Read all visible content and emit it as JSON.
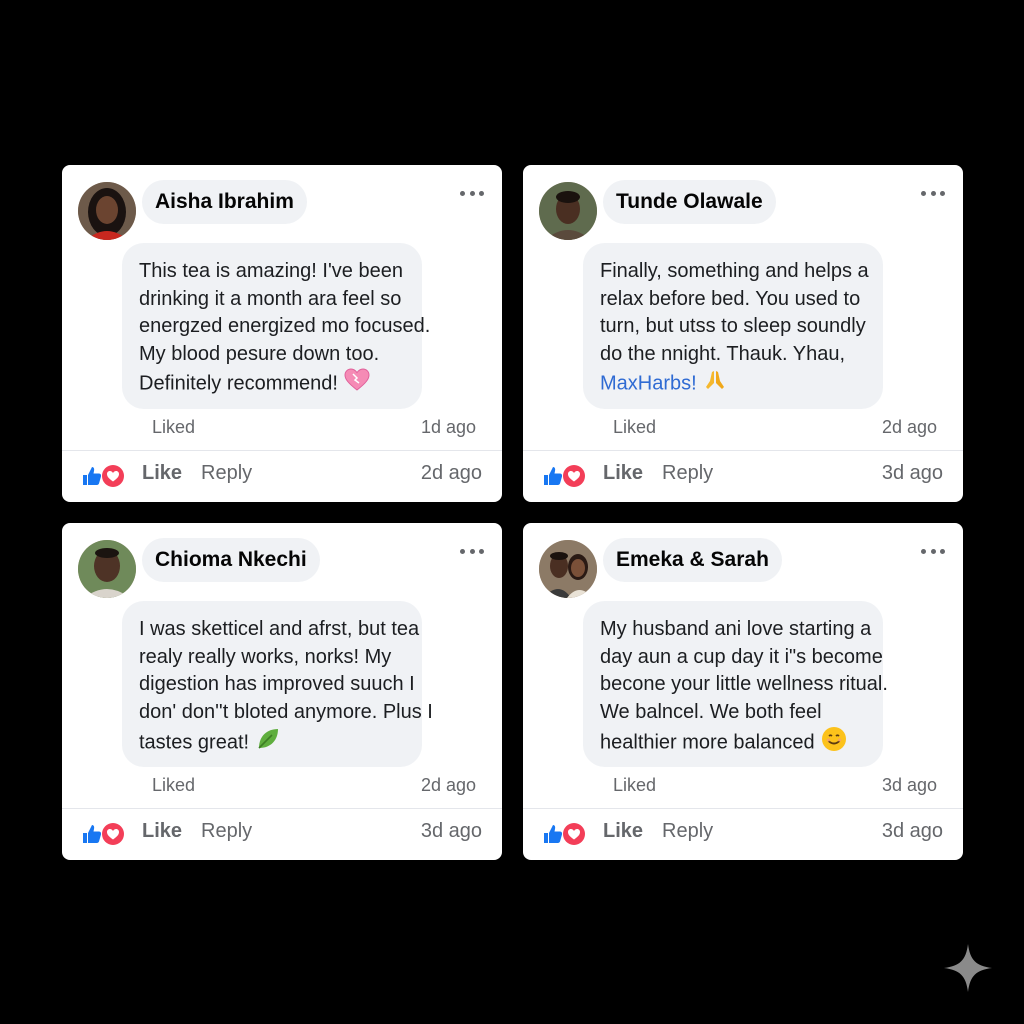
{
  "comments": [
    {
      "name": "Aisha Ibrahim",
      "lines": [
        "This tea is amazing! I've been",
        "drinking it a month ara feel so",
        "energzed energized mo focused.",
        "My blood pesure down too.",
        "Definitely recommend!"
      ],
      "last_emoji": "heart-icon",
      "link": "",
      "liked_label": "Liked",
      "meta_time": "1d ago",
      "footer_time": "2d ago"
    },
    {
      "name": "Tunde Olawale",
      "lines": [
        "Finally, something and helps a",
        "relax before bed. You used  to",
        "turn, but utss to sleep soundly",
        "do the nnight. Thauk. Yhau,"
      ],
      "last_emoji": "praying-hands-icon",
      "link": "MaxHarbs!",
      "liked_label": "Liked",
      "meta_time": "2d ago",
      "footer_time": "3d ago"
    },
    {
      "name": "Chioma Nkechi",
      "lines": [
        "I was sketticel and afrst, but tea",
        "realy really works, norks! My",
        "digestion has improved suuch I",
        "don' don''t bloted anymore. Plus I",
        "tastes great!"
      ],
      "last_emoji": "leaf-icon",
      "link": "",
      "liked_label": "Liked",
      "meta_time": "2d ago",
      "footer_time": "3d ago"
    },
    {
      "name": "Emeka & Sarah",
      "lines": [
        "My husband ani love starting a",
        "day aun a cup day it i\"s become",
        "becone your little wellness ritual.",
        "We balncel. We both feel",
        "healthier more balanced"
      ],
      "last_emoji": "smiling-face-icon",
      "link": "",
      "liked_label": "Liked",
      "meta_time": "3d ago",
      "footer_time": "3d ago"
    }
  ],
  "actions": {
    "like_label": "Like",
    "reply_label": "Reply"
  },
  "colors": {
    "like_blue": "#1877f2",
    "love_red": "#f33e58",
    "link_blue": "#2f6bd3",
    "bubble_gray": "#f0f2f5"
  }
}
